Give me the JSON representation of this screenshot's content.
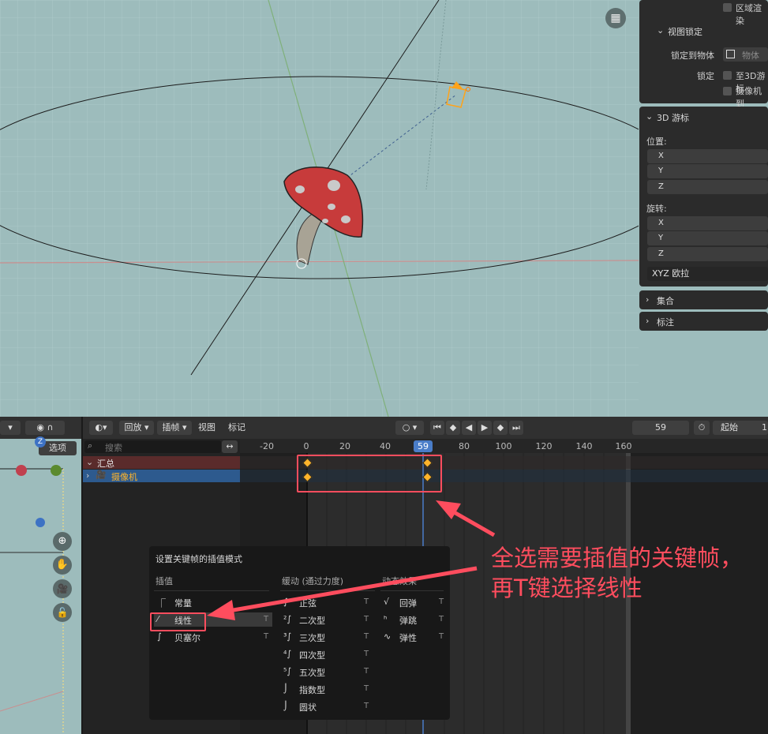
{
  "npanel": {
    "region_overlay_label": "区域渲染",
    "view_lock": {
      "title": "视图锁定",
      "lock_to_object_label": "锁定到物体",
      "object_placeholder": "物体",
      "lock_label": "锁定",
      "to_3d_cursor": "至3D游标",
      "camera_to_view": "摄像机到"
    },
    "cursor3d": {
      "title": "3D 游标",
      "location_label": "位置:",
      "rotation_label": "旋转:",
      "axes": [
        "X",
        "Y",
        "Z"
      ],
      "rotation_mode": "XYZ 欧拉"
    },
    "collections": "集合",
    "annotations": "标注"
  },
  "left_editor": {
    "select_menu": "选项"
  },
  "timeline_header": {
    "playback_menu": "回放",
    "keying_menu": "插帧",
    "view_menu": "视图",
    "marker_menu": "标记",
    "current_frame": "59",
    "start_label": "起始",
    "start_value": "1"
  },
  "channels": {
    "search_placeholder": "搜索",
    "summary": "汇总",
    "camera": "摄像机"
  },
  "ruler": {
    "ticks": [
      "-20",
      "0",
      "20",
      "40",
      "80",
      "100",
      "120",
      "140",
      "160"
    ],
    "current": "59"
  },
  "popup": {
    "title": "设置关键帧的插值模式",
    "col_interp": "插值",
    "col_easing": "缓动 (通过力度)",
    "col_dynamic": "动态效果",
    "interp_items": [
      {
        "label": "常量",
        "key": ""
      },
      {
        "label": "线性",
        "key": "T"
      },
      {
        "label": "贝塞尔",
        "key": "T"
      }
    ],
    "easing_items": [
      {
        "label": "正弦",
        "key": "T"
      },
      {
        "label": "二次型",
        "key": "T"
      },
      {
        "label": "三次型",
        "key": "T"
      },
      {
        "label": "四次型",
        "key": "T"
      },
      {
        "label": "五次型",
        "key": "T"
      },
      {
        "label": "指数型",
        "key": "T"
      },
      {
        "label": "圆状",
        "key": "T"
      }
    ],
    "dynamic_items": [
      {
        "label": "回弹",
        "key": "T"
      },
      {
        "label": "弹跳",
        "key": "T"
      },
      {
        "label": "弹性",
        "key": "T"
      }
    ]
  },
  "annotation": {
    "line1": "全选需要插值的关键帧，",
    "line2": "再T键选择线性",
    "color": "#ff4d5e"
  },
  "colors": {
    "viewport_bg": "#9dbcbc",
    "mushroom_red": "#c73b3b",
    "keyframe": "#ffb42b",
    "playhead": "#4a7dc8",
    "annotation": "#ff4d5e"
  }
}
